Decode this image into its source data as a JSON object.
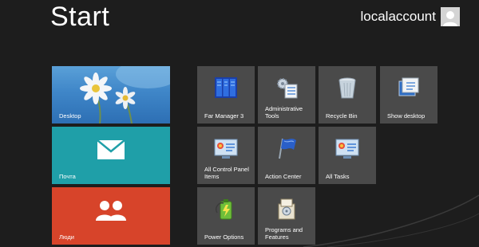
{
  "header": {
    "title": "Start",
    "username": "localaccount"
  },
  "tiles": [
    {
      "label": "Desktop",
      "color": "#3f86c8",
      "icon": "flower-photo-icon"
    },
    {
      "label": "Почта",
      "color": "#1f9fa8",
      "icon": "mail-icon"
    },
    {
      "label": "Люди",
      "color": "#d7442a",
      "icon": "people-icon"
    },
    {
      "label": "Far Manager 3",
      "icon": "far-manager-icon"
    },
    {
      "label": "Administrative Tools",
      "icon": "administrative-tools-icon"
    },
    {
      "label": "Recycle Bin",
      "icon": "recycle-bin-icon"
    },
    {
      "label": "Show desktop",
      "icon": "show-desktop-icon"
    },
    {
      "label": "All Control Panel Items",
      "icon": "control-panel-icon"
    },
    {
      "label": "Action Center",
      "icon": "action-center-flag-icon"
    },
    {
      "label": "All Tasks",
      "icon": "control-panel-icon"
    },
    {
      "label": "Power Options",
      "icon": "power-options-icon"
    },
    {
      "label": "Programs and Features",
      "icon": "programs-features-icon"
    }
  ],
  "colors": {
    "background": "#1d1d1d",
    "small_tile": "#4a4a4a"
  }
}
